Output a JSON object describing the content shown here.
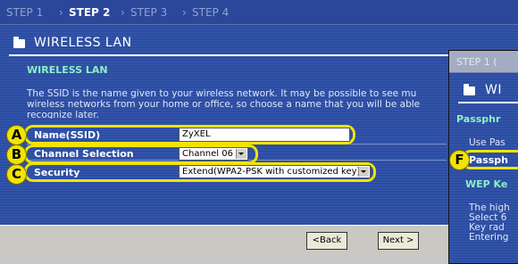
{
  "steps": [
    "STEP 1",
    "STEP 2",
    "STEP 3",
    "STEP 4"
  ],
  "step_arrow": "›",
  "page_title": "WIRELESS LAN",
  "section": "WIRELESS LAN",
  "description": [
    "The SSID is the name given to your wireless network. It may be possible to see mu",
    "wireless networks from your home or office, so choose a name that you will be able",
    "recognize later."
  ],
  "callouts": [
    "A",
    "B",
    "C"
  ],
  "fields": {
    "ssid": {
      "label": "Name(SSID)",
      "value": "ZyXEL"
    },
    "channel": {
      "label": "Channel Selection",
      "value": "Channel 06"
    },
    "security": {
      "label": "Security",
      "value": "Extend(WPA2-PSK with customized key)"
    }
  },
  "buttons": {
    "back": "<Back",
    "next": "Next >"
  },
  "second_screen": {
    "steps_fragment": "STEP 1 (",
    "title_fragment": "WI",
    "section_fragment": "Passphr",
    "use_fragment": "Use Pas",
    "callout": "F",
    "field_fragment": "Passph",
    "wep_fragment": "WEP Ke",
    "text_fragments": [
      "The high",
      "Select 6",
      "Key rad",
      "Entering"
    ]
  },
  "colors": {
    "accent": "#f0e400",
    "section_text": "#8ef0c6",
    "background": "#2b4da3"
  }
}
